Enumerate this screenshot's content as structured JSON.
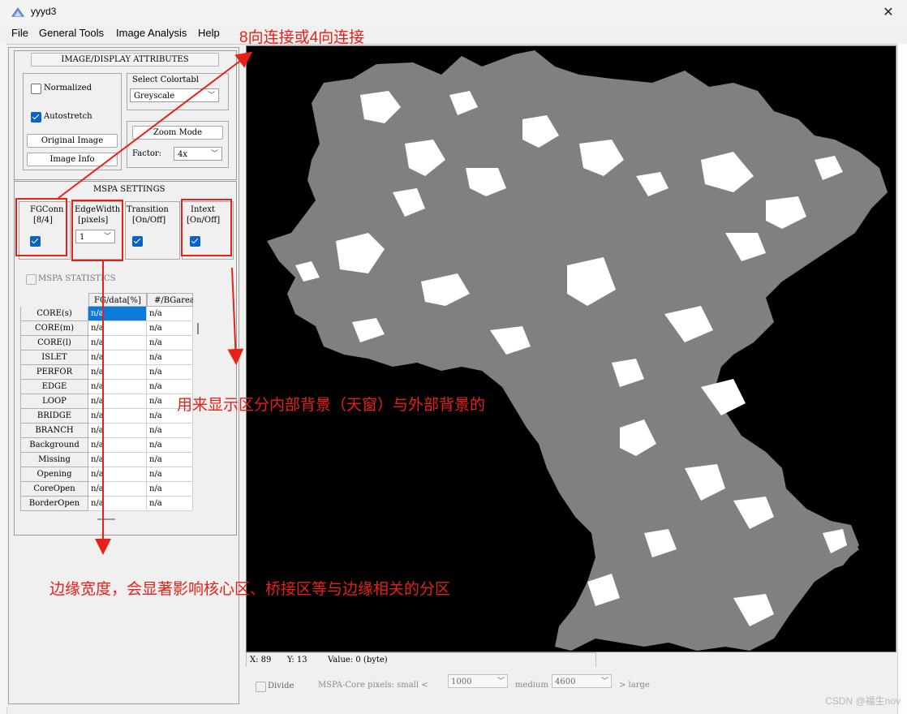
{
  "window": {
    "title": "yyyd3",
    "close_glyph": "✕"
  },
  "menu": [
    "File",
    "General Tools",
    "Image Analysis",
    "Help"
  ],
  "image_display_attributes": {
    "group_title": "IMAGE/DISPLAY ATTRIBUTES",
    "normalized": {
      "label": "Normalized",
      "checked": false
    },
    "autostretch": {
      "label": "Autostretch",
      "checked": true
    },
    "original_image_button": "Original Image",
    "image_info_button": "Image Info",
    "colortable": {
      "label": "Select Colortabl",
      "value": "Greyscale"
    },
    "zoom_mode_button": "Zoom Mode",
    "factor": {
      "label": "Factor:",
      "value": "4x"
    }
  },
  "mspa_settings": {
    "group_title": "MSPA SETTINGS",
    "fgconn": {
      "label_line1": "FGConn",
      "label_line2": "[8/4]",
      "checked": true
    },
    "edgewidth": {
      "label_line1": "EdgeWidth",
      "label_line2": "[pixels]",
      "value": "1"
    },
    "transition": {
      "label_line1": "Transition",
      "label_line2": "[On/Off]",
      "checked": true
    },
    "intext": {
      "label_line1": "Intext",
      "label_line2": "[On/Off]",
      "checked": true
    },
    "statistics": {
      "label": "MSPA STATISTICS",
      "checked": false
    }
  },
  "stats_table": {
    "headers": [
      "FG/data[%]",
      "#/BGarea"
    ],
    "rows": [
      {
        "label": "CORE(s)",
        "fg": "n/a",
        "bg": "n/a"
      },
      {
        "label": "CORE(m)",
        "fg": "n/a",
        "bg": "n/a"
      },
      {
        "label": "CORE(l)",
        "fg": "n/a",
        "bg": "n/a"
      },
      {
        "label": "ISLET",
        "fg": "n/a",
        "bg": "n/a"
      },
      {
        "label": "PERFOR",
        "fg": "n/a",
        "bg": "n/a"
      },
      {
        "label": "EDGE",
        "fg": "n/a",
        "bg": "n/a"
      },
      {
        "label": "LOOP",
        "fg": "n/a",
        "bg": "n/a"
      },
      {
        "label": "BRIDGE",
        "fg": "n/a",
        "bg": "n/a"
      },
      {
        "label": "BRANCH",
        "fg": "n/a",
        "bg": "n/a"
      },
      {
        "label": "Background",
        "fg": "n/a",
        "bg": "n/a"
      },
      {
        "label": "Missing",
        "fg": "n/a",
        "bg": "n/a"
      },
      {
        "label": "Opening",
        "fg": "n/a",
        "bg": "n/a"
      },
      {
        "label": "CoreOpen",
        "fg": "n/a",
        "bg": "n/a"
      },
      {
        "label": "BorderOpen",
        "fg": "n/a",
        "bg": "n/a"
      }
    ]
  },
  "status": {
    "x_label": "X: 89",
    "y_label": "Y: 13",
    "value_label": "Value: 0 (byte)"
  },
  "bottom": {
    "divide_label": "Divide",
    "mspa_core_label": "MSPA-Core pixels: small <",
    "small_value": "1000",
    "medium_label": "medium",
    "medium_value": "4600",
    "large_label": "> large"
  },
  "annotations": {
    "fgconn_note": "8向连接或4向连接",
    "intext_note": "用来显示区分内部背景（天窗）与外部背景的",
    "edgewidth_note": "边缘宽度，会显著影响核心区、桥接区等与边缘相关的分区"
  },
  "watermark": "CSDN @福生nov",
  "colors": {
    "annotation_red": "#e82018",
    "selection_blue": "#0a7bd8",
    "foreground_gray": "#808080"
  }
}
